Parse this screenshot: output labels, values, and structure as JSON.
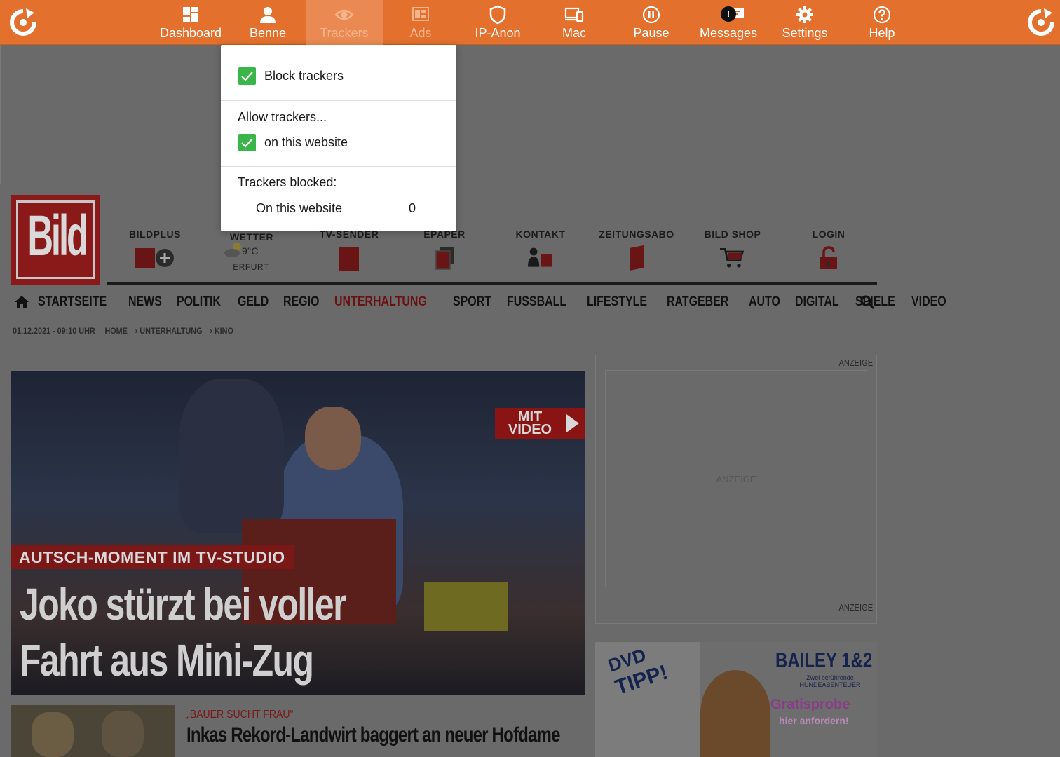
{
  "toolbar": {
    "items": [
      {
        "label": "Dashboard",
        "icon": "dashboard-icon"
      },
      {
        "label": "Benne",
        "icon": "user-icon"
      },
      {
        "label": "Trackers",
        "icon": "eye-icon"
      },
      {
        "label": "Ads",
        "icon": "ads-icon"
      },
      {
        "label": "IP-Anon",
        "icon": "shield-icon"
      },
      {
        "label": "Mac",
        "icon": "devices-icon"
      },
      {
        "label": "Pause",
        "icon": "pause-icon"
      },
      {
        "label": "Messages",
        "icon": "messages-icon",
        "badge": "!"
      },
      {
        "label": "Settings",
        "icon": "gear-icon"
      },
      {
        "label": "Help",
        "icon": "help-icon"
      }
    ],
    "colors": {
      "bar": "#e3702c",
      "active": "#ea8a52"
    }
  },
  "popover": {
    "block_trackers": "Block trackers",
    "allow_trackers": "Allow trackers...",
    "on_this_website": "on this website",
    "trackers_blocked": "Trackers blocked:",
    "on_this_website_count_label": "On this website",
    "count": "0",
    "checkbox_color": "#39b54a"
  },
  "site": {
    "logo": "Bild",
    "services": {
      "bildplus": "BILDPLUS",
      "wetter": "WETTER",
      "temp": "9°C",
      "city": "ERFURT",
      "tvsender": "TV-SENDER",
      "epaper": "EPAPER",
      "kontakt": "KONTAKT",
      "zeitungsabo": "ZEITUNGSABO",
      "shop": "BILD SHOP",
      "login": "LOGIN"
    },
    "nav": [
      "STARTSEITE",
      "NEWS",
      "POLITIK",
      "GELD",
      "REGIO",
      "UNTERHALTUNG",
      "SPORT",
      "FUSSBALL",
      "LIFESTYLE",
      "RATGEBER",
      "AUTO",
      "DIGITAL",
      "SPIELE",
      "VIDEO"
    ],
    "nav_active": "UNTERHALTUNG",
    "breadcrumb": {
      "date": "01.12.2021 - 09:10 UHR",
      "home": "HOME",
      "cat": "› UNTERHALTUNG",
      "sub": "› KINO"
    },
    "hero": {
      "badge": "MIT VIDEO",
      "kicker": "AUTSCH-MOMENT IM TV-STUDIO",
      "headline_1": "Joko stürzt bei voller",
      "headline_2": "Fahrt aus Mini-Zug"
    },
    "ad": {
      "top": "ANZEIGE",
      "center": "ANZEIGE",
      "bottom": "ANZEIGE"
    },
    "promo": {
      "dvd": "DVD",
      "tipp": "TIPP!",
      "title": "BAILEY 1&2",
      "subtitle": "Zwei berührende HUNDEABENTEUER",
      "gratis": "Gratisprobe",
      "hier": "hier anfordern!"
    },
    "teaser": {
      "kicker": "„BAUER SUCHT FRAU“",
      "title": "Inkas Rekord-Landwirt baggert an neuer Hofdame"
    }
  }
}
